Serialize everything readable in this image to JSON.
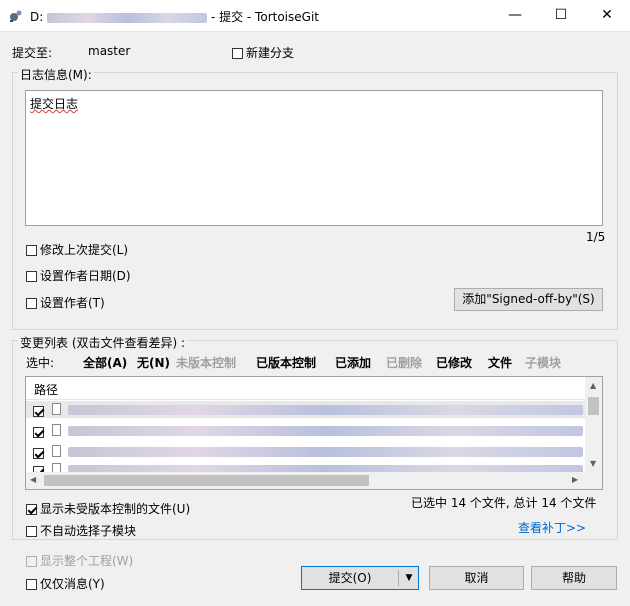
{
  "window": {
    "title_prefix": "D:",
    "title_suffix": "- 提交 - TortoiseGit",
    "minimize": "—",
    "maximize": "☐",
    "close": "✕"
  },
  "commit_to": {
    "label": "提交至:",
    "branch": "master",
    "new_branch_label": "新建分支"
  },
  "message": {
    "group_title": "日志信息(M):",
    "text": "提交日志",
    "counter": "1/5"
  },
  "options": {
    "amend": "修改上次提交(L)",
    "author_date": "设置作者日期(D)",
    "author": "设置作者(T)",
    "signed_off_button": "添加\"Signed-off-by\"(S)"
  },
  "changes": {
    "group_title": "变更列表 (双击文件查看差异) :",
    "select_label": "选中:",
    "filters": [
      {
        "label": "全部(A)",
        "enabled": true
      },
      {
        "label": "无(N)",
        "enabled": true
      },
      {
        "label": "未版本控制",
        "enabled": false
      },
      {
        "label": "已版本控制",
        "enabled": true
      },
      {
        "label": "已添加",
        "enabled": true
      },
      {
        "label": "已删除",
        "enabled": false
      },
      {
        "label": "已修改",
        "enabled": true
      },
      {
        "label": "文件",
        "enabled": true
      },
      {
        "label": "子模块",
        "enabled": false
      }
    ],
    "column_path": "路径",
    "rows": [
      {
        "checked": true
      },
      {
        "checked": true
      },
      {
        "checked": true
      },
      {
        "checked": true
      }
    ],
    "show_unversioned": "显示未受版本控制的文件(U)",
    "no_auto_submodule": "不自动选择子模块",
    "summary": "已选中 14 个文件, 总计 14 个文件",
    "view_patch": "查看补丁>>"
  },
  "footer": {
    "show_whole_project": "显示整个工程(W)",
    "message_only": "仅仅消息(Y)",
    "commit_button": "提交(O)",
    "cancel_button": "取消",
    "help_button": "帮助"
  },
  "colors": {
    "window_bg": "#f0f0f0",
    "link": "#0066cc",
    "disabled": "#a0a0a0"
  }
}
